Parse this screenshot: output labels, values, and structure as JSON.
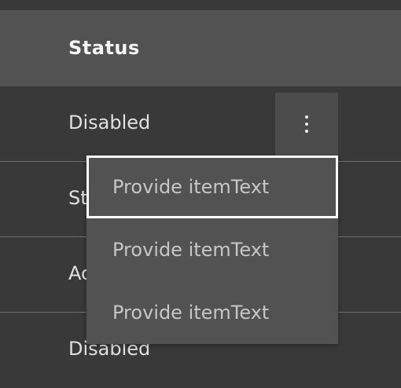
{
  "table": {
    "header": {
      "status": "Status"
    },
    "rows": [
      {
        "status": "Disabled"
      },
      {
        "status": "Starting"
      },
      {
        "status": "Active"
      },
      {
        "status": "Disabled"
      }
    ]
  },
  "overflow_menu": {
    "icon": "overflow-vertical-icon",
    "items": [
      {
        "label": "Provide itemText",
        "focused": true
      },
      {
        "label": "Provide itemText",
        "focused": false
      },
      {
        "label": "Provide itemText",
        "focused": false
      }
    ]
  },
  "colors": {
    "background": "#393939",
    "header": "#525252",
    "menu": "#525252",
    "focus": "#ffffff"
  }
}
